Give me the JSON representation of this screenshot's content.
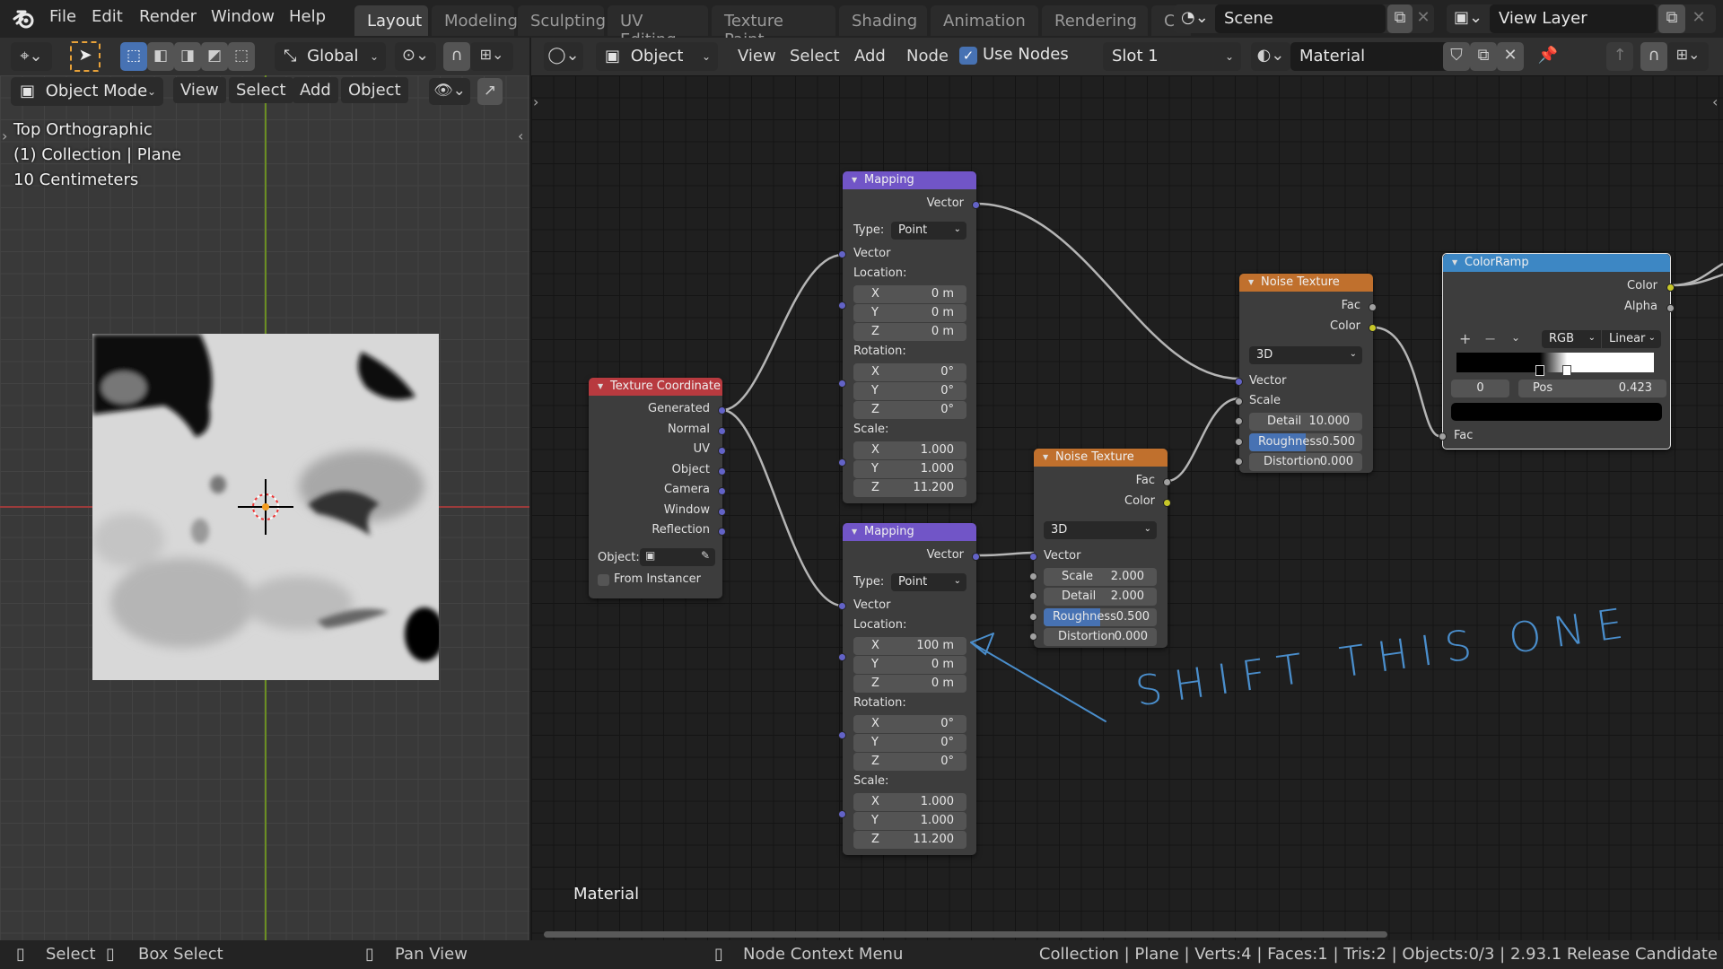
{
  "topbar": {
    "logo": "blender-logo",
    "menus": [
      "File",
      "Edit",
      "Render",
      "Window",
      "Help"
    ],
    "workspaces": [
      {
        "label": "Layout",
        "active": true
      },
      {
        "label": "Modeling",
        "active": false
      },
      {
        "label": "Sculpting",
        "active": false
      },
      {
        "label": "UV Editing",
        "active": false
      },
      {
        "label": "Texture Paint",
        "active": false
      },
      {
        "label": "Shading",
        "active": false
      },
      {
        "label": "Animation",
        "active": false
      },
      {
        "label": "Rendering",
        "active": false
      },
      {
        "label": "Coı",
        "active": false
      }
    ],
    "scene": {
      "icon": "scene-icon",
      "value": "Scene"
    },
    "view_layer": {
      "icon": "view-layer-icon",
      "value": "View Layer"
    }
  },
  "viewport_header": {
    "transform_orientation": "Global",
    "mode": "Object Mode",
    "menus": [
      "View",
      "Select",
      "Add",
      "Object"
    ]
  },
  "viewport_overlay": {
    "view_name": "Top Orthographic",
    "collection": "(1) Collection | Plane",
    "scale": "10 Centimeters"
  },
  "node_header": {
    "object_type": "Object",
    "menus": [
      "View",
      "Select",
      "Add",
      "Node"
    ],
    "use_nodes": {
      "label": "Use Nodes",
      "checked": true
    },
    "slot": "Slot 1",
    "material": "Material"
  },
  "node_editor": {
    "material_label": "Material",
    "annotation": "SHIFT THIS ONE",
    "annotation_color": "#4a8ecc"
  },
  "nodes": {
    "texcoord": {
      "title": "Texture Coordinate",
      "header_color": "#b83a3f",
      "outputs": [
        "Generated",
        "Normal",
        "UV",
        "Object",
        "Camera",
        "Window",
        "Reflection"
      ],
      "object_label": "Object:",
      "from_instancer": {
        "label": "From Instancer",
        "checked": false
      }
    },
    "mapping1": {
      "title": "Mapping",
      "header_color": "#7155c7",
      "output": "Vector",
      "type_label": "Type:",
      "type_value": "Point",
      "input": "Vector",
      "location_label": "Location:",
      "location": [
        {
          "axis": "X",
          "value": "0 m"
        },
        {
          "axis": "Y",
          "value": "0 m"
        },
        {
          "axis": "Z",
          "value": "0 m"
        }
      ],
      "rotation_label": "Rotation:",
      "rotation": [
        {
          "axis": "X",
          "value": "0°"
        },
        {
          "axis": "Y",
          "value": "0°"
        },
        {
          "axis": "Z",
          "value": "0°"
        }
      ],
      "scale_label": "Scale:",
      "scale": [
        {
          "axis": "X",
          "value": "1.000"
        },
        {
          "axis": "Y",
          "value": "1.000"
        },
        {
          "axis": "Z",
          "value": "11.200"
        }
      ]
    },
    "mapping2": {
      "title": "Mapping",
      "header_color": "#7155c7",
      "output": "Vector",
      "type_label": "Type:",
      "type_value": "Point",
      "input": "Vector",
      "location_label": "Location:",
      "location": [
        {
          "axis": "X",
          "value": "100 m"
        },
        {
          "axis": "Y",
          "value": "0 m"
        },
        {
          "axis": "Z",
          "value": "0 m"
        }
      ],
      "rotation_label": "Rotation:",
      "rotation": [
        {
          "axis": "X",
          "value": "0°"
        },
        {
          "axis": "Y",
          "value": "0°"
        },
        {
          "axis": "Z",
          "value": "0°"
        }
      ],
      "scale_label": "Scale:",
      "scale": [
        {
          "axis": "X",
          "value": "1.000"
        },
        {
          "axis": "Y",
          "value": "1.000"
        },
        {
          "axis": "Z",
          "value": "11.200"
        }
      ]
    },
    "noise1": {
      "title": "Noise Texture",
      "header_color": "#c0702d",
      "outputs": [
        "Fac",
        "Color"
      ],
      "dimensions": "3D",
      "vector_label": "Vector",
      "scale_label": "Scale",
      "detail": {
        "label": "Detail",
        "value": "10.000"
      },
      "roughness": {
        "label": "Roughness",
        "value": "0.500",
        "fraction": 0.5
      },
      "distortion": {
        "label": "Distortion",
        "value": "0.000"
      }
    },
    "noise2": {
      "title": "Noise Texture",
      "header_color": "#c0702d",
      "outputs": [
        "Fac",
        "Color"
      ],
      "dimensions": "3D",
      "vector_label": "Vector",
      "scale": {
        "label": "Scale",
        "value": "2.000"
      },
      "detail": {
        "label": "Detail",
        "value": "2.000"
      },
      "roughness": {
        "label": "Roughness",
        "value": "0.500",
        "fraction": 0.5
      },
      "distortion": {
        "label": "Distortion",
        "value": "0.000"
      }
    },
    "colorramp": {
      "title": "ColorRamp",
      "header_color": "#3d87c4",
      "outputs": [
        "Color",
        "Alpha"
      ],
      "add": "+",
      "remove": "−",
      "color_mode": "RGB",
      "interpolation": "Linear",
      "stop_index": "0",
      "pos_label": "Pos",
      "pos_value": "0.423",
      "stops": [
        0.423,
        0.56
      ],
      "input": "Fac"
    }
  },
  "statusbar": {
    "items": [
      "Select",
      "Box Select",
      "Pan View",
      "Node Context Menu"
    ],
    "info": "Collection | Plane | Verts:4 | Faces:1 | Tris:2 | Objects:0/3 | 2.93.1 Release Candidate"
  }
}
